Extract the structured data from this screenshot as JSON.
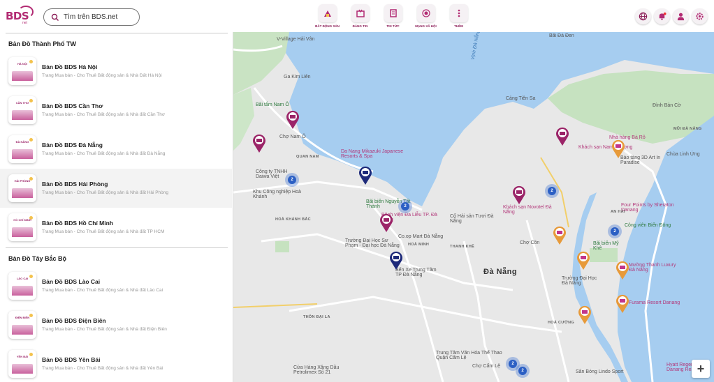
{
  "header": {
    "logo_text": "BDS",
    "logo_sub": "net",
    "search_placeholder": "Tìm trên BDS.net",
    "nav": [
      {
        "label": "BẤT ĐỘNG SẢN",
        "icon": "building-icon"
      },
      {
        "label": "ĐĂNG TIN",
        "icon": "post-icon"
      },
      {
        "label": "TIN TỨC",
        "icon": "news-icon"
      },
      {
        "label": "MẠNG XÃ HỘI",
        "icon": "social-icon"
      },
      {
        "label": "THÊM",
        "icon": "more-icon"
      }
    ],
    "right_icons": [
      "globe-icon",
      "bell-icon",
      "user-icon",
      "settings-icon"
    ]
  },
  "sidebar": {
    "sections": [
      {
        "title": "Bản Đồ Thành Phố TW",
        "items": [
          {
            "thumb": "HÀ NỘI",
            "title": "Bản Đồ BDS Hà Nội",
            "desc": "Trang Mua bán - Cho Thuê Bất động sản & Nhà Đất Hà Nội"
          },
          {
            "thumb": "CẦN THƠ",
            "title": "Bản Đồ BDS Cần Thơ",
            "desc": "Trang Mua bán - Cho Thuê Bất động sản & Nhà đất Cần Thơ"
          },
          {
            "thumb": "ĐÀ NẴNG",
            "title": "Bản Đồ BDS Đà Nẵng",
            "desc": "Trang Mua bán - Cho Thuê Bất động sản & Nhà đất Đà Nẵng"
          },
          {
            "thumb": "HẢI PHÒNG",
            "title": "Bản Đồ BDS Hải Phòng",
            "desc": "Trang Mua bán - Cho Thuê Bất động sản & Nhà đất Hải Phòng"
          },
          {
            "thumb": "HỒ CHÍ MINH",
            "title": "Bản Đồ BDS Hồ Chí Minh",
            "desc": "Trang Mua bán - Cho Thuê Bất động sản & Nhà đất TP HCM"
          }
        ]
      },
      {
        "title": "Bản Đồ Tây Bắc Bộ",
        "items": [
          {
            "thumb": "LÀO CAI",
            "title": "Bản Đồ BDS Lào Cai",
            "desc": "Trang Mua bán - Cho Thuê Bất động sản & Nhà đất Lào Cai"
          },
          {
            "thumb": "ĐIỆN BIÊN",
            "title": "Bản Đồ BDS Điện Biên",
            "desc": "Trang Mua bán - Cho Thuê Bất động sản & Nhà đất Điện Biên"
          },
          {
            "thumb": "YÊN BÁI",
            "title": "Bản Đồ BDS Yên Bái",
            "desc": "Trang Mua bán - Cho Thuê Bất động sản & Nhà đất Yên Bái"
          }
        ]
      }
    ]
  },
  "map": {
    "labels": {
      "city": "Đà Nẵng",
      "vinh": "Vịnh Đà Nẵng",
      "van": "V-Village Hải Vân",
      "kim_lien": "Ga Kim Liên",
      "bai_tam": "Bãi tắm Nam Ô",
      "cho_nam_o": "Chợ Nam Ô",
      "quan_nam": "QUAN NAM",
      "cong_ty": "Công ty TNHH Daiwa Việt",
      "kcn": "Khu Công nghiệp Hoà Khánh",
      "mikazuki": "Da Nang Mikazuki Japanese Resorts & Spa",
      "bai_bien": "Bãi biển Nguyễn Tất Thành",
      "cang_tien_sa": "Cảng Tiên Sa",
      "den_ban_co": "Đình Bản Cờ",
      "ba_ro": "Nhà hàng Bà Rô",
      "khach_san": "Khách sạn Nam Phương",
      "bao_tang": "Bảo tàng 3D Art In Paradise",
      "chua_linh_ung": "Chùa Linh Ứng",
      "four_points": "Four Points by Sheraton Danang",
      "novotel": "Khách sạn Novotel Đà Nẵng",
      "cong_vien": "Công viên Biển Đông",
      "bai_bien_my_khe": "Bãi biển Mỹ Khê",
      "muong_thanh": "Mường Thanh Luxury Đà Nẵng",
      "furama": "Furama Resort Danang",
      "cho_con": "Chợ Cồn",
      "coop": "Co.op Mart Đà Nẵng",
      "su_pham": "Trường Đại Học Sư Phạm - Đại học Đà Nẵng",
      "ben_xe": "Bến Xe Trung Tâm TP Đà Nẵng",
      "thon_dai_la": "THÔN ĐẠI LA",
      "hoa_cuong": "HOÀ CƯỜNG",
      "trung_tam": "Trung Tâm Văn Hóa Thể Thao Quận Cẩm Lệ",
      "petrolimex": "Cửa Hàng Xăng Dầu Petrolimex Số 21",
      "hyatt": "Hyatt Regency Danang Resort",
      "song_bong": "Sân Bóng Lindo Sport",
      "cho_cam_le": "Chợ Cẩm Lệ",
      "dai_hoc_dn": "Trường Đại Học Đà Nẵng",
      "thanh_khe": "THANH KHÊ",
      "hoa_minh": "HOÀ MINH",
      "hoa_khanh_bac": "HOÀ KHÁNH BẮC",
      "an_hai": "AN HẢI",
      "mui_da_nang": "MŨI ĐÀ NẴNG",
      "bai_da_den": "Bãi Đá Đen",
      "hai_son": "Cổ Hải sản Tươi Đà Nẵng",
      "benh_vien": "Bệnh viện Đa Liễu TP. Đà Nẵng"
    },
    "clusters": [
      "2",
      "2",
      "2",
      "2",
      "2",
      "2"
    ],
    "zoom_in": "+"
  }
}
